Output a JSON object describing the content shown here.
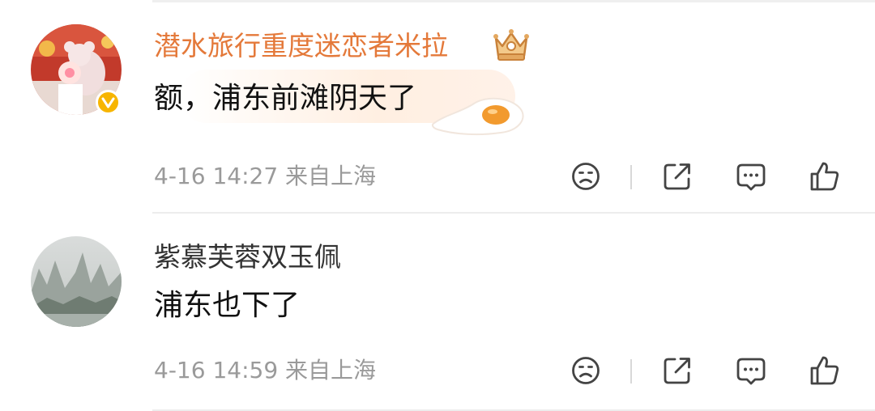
{
  "comments": [
    {
      "username": "潜水旅行重度迷恋者米拉",
      "text": "额，浦东前滩阴天了",
      "meta": "4-16 14:27 来自上海",
      "accent_color": "#e4793a"
    },
    {
      "username": "紫慕芙蓉双玉佩",
      "text": "浦东也下了",
      "meta": "4-16 14:59 来自上海",
      "accent_color": "#333333"
    }
  ],
  "icons": [
    "dislike-icon",
    "share-icon",
    "comment-icon",
    "like-icon",
    "crown-badge-icon",
    "verified-badge-icon",
    "fried-egg-sticker-icon"
  ]
}
